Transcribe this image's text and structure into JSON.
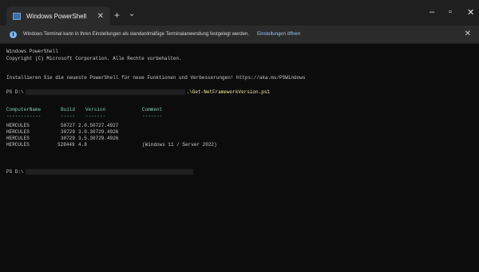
{
  "window": {
    "tab_title": "Windows PowerShell",
    "tab_close_icon": "close-icon",
    "new_tab_icon": "plus-icon",
    "dropdown_icon": "chevron-down-icon",
    "minimize_icon": "minimize-icon",
    "maximize_icon": "maximize-icon",
    "close_icon": "close-icon"
  },
  "infobar": {
    "text": "Windows Terminal kann in Ihren Einstellungen als standardmäßige Terminalanwendung festgelegt werden.",
    "link": "Einstellungen öffnen"
  },
  "terminal": {
    "banner_line1": "Windows PowerShell",
    "banner_line2": "Copyright (C) Microsoft Corporation. Alle Rechte vorbehalten.",
    "install_line": "Installieren Sie die neueste PowerShell für neue Funktionen und Verbesserungen! https://aka.ms/PSWindows",
    "prompt_prefix": "PS D:\\",
    "command": ".\\Get-NetFrameworkVersion.ps1",
    "prompt2_prefix": "PS D:\\",
    "table": {
      "headers": [
        "ComputerName",
        "Build",
        "Version",
        "Comment"
      ],
      "separators": [
        "------------",
        "-----",
        "-------",
        "-------"
      ],
      "rows": [
        [
          "HERCULES",
          "50727",
          "2.0.50727.4927",
          ""
        ],
        [
          "HERCULES",
          "30729",
          "3.0.30729.4926",
          ""
        ],
        [
          "HERCULES",
          "30729",
          "3.5.30729.4926",
          ""
        ],
        [
          "HERCULES",
          "528449",
          "4.8",
          "(Windows 11 / Server 2022)"
        ]
      ]
    }
  },
  "colors": {
    "background": "#0c0c0c",
    "command": "#f9f1a5",
    "header": "#7fc9b6",
    "accent": "#7fb2f0"
  }
}
